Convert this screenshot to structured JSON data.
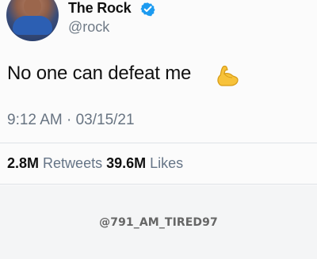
{
  "tweet": {
    "display_name": "The Rock",
    "handle": "@rock",
    "text": "No one can defeat me",
    "emoji_icon": "flexed-biceps-icon",
    "timestamp": "9:12 AM · 03/15/21",
    "retweets_count": "2.8M",
    "retweets_label": "Retweets",
    "likes_count": "39.6M",
    "likes_label": "Likes",
    "verified_color": "#1d9bf0"
  },
  "watermark": "@791_AM_TIRED97"
}
